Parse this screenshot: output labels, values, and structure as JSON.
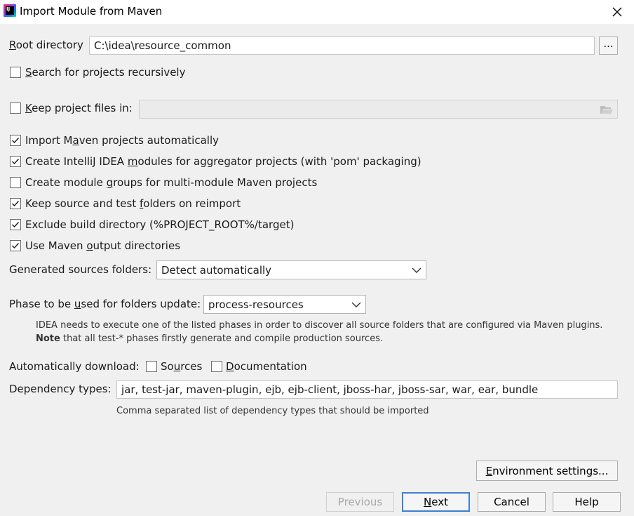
{
  "window": {
    "title": "Import Module from Maven",
    "app_icon": "intellij-idea-icon",
    "app_icon_text": "IJ"
  },
  "root_directory": {
    "label_prefix": "",
    "label_mnemonic": "R",
    "label_rest": "oot directory",
    "value": "C:\\idea\\resource_common",
    "browse_label": "..."
  },
  "search_recursively": {
    "checked": false,
    "label_mnemonic": "S",
    "label_rest": "earch for projects recursively"
  },
  "keep_project_files": {
    "checked": false,
    "label_mnemonic": "K",
    "label_rest": "eep project files in:",
    "value": ""
  },
  "options": [
    {
      "checked": true,
      "pre": "Import M",
      "mn": "a",
      "post": "ven projects automatically"
    },
    {
      "checked": true,
      "pre": "Create IntelliJ IDEA ",
      "mn": "m",
      "post": "odules for aggregator projects (with 'pom' packaging)"
    },
    {
      "checked": false,
      "pre": "Create module ",
      "mn": "g",
      "post": "roups for multi-module Maven projects"
    },
    {
      "checked": true,
      "pre": "Keep source and test ",
      "mn": "f",
      "post": "olders on reimport"
    },
    {
      "checked": true,
      "pre": "Exclude build directory (%PROJECT_ROOT%/target)",
      "mn": "",
      "post": ""
    },
    {
      "checked": true,
      "pre": "Use Maven ",
      "mn": "o",
      "post": "utput directories"
    }
  ],
  "generated_sources": {
    "label": "Generated sources folders:",
    "selected": "Detect automatically"
  },
  "phase": {
    "label_pre": "Phase to be ",
    "label_mn": "u",
    "label_post": "sed for folders update:",
    "selected": "process-resources",
    "hint_line1": "IDEA needs to execute one of the listed phases in order to discover all source folders that are configured via Maven plugins.",
    "hint_bold": "Note",
    "hint_line2": " that all test-* phases firstly generate and compile production sources."
  },
  "auto_download": {
    "label": "Automatically download:",
    "sources": {
      "checked": false,
      "pre": "So",
      "mn": "u",
      "post": "rces"
    },
    "documentation": {
      "checked": false,
      "pre": "",
      "mn": "D",
      "post": "ocumentation"
    }
  },
  "dependency_types": {
    "label": "Dependency types:",
    "value": "jar, test-jar, maven-plugin, ejb, ejb-client, jboss-har, jboss-sar, war, ear, bundle",
    "hint": "Comma separated list of dependency types that should be imported"
  },
  "buttons": {
    "environment_pre": "",
    "environment_mn": "E",
    "environment_post": "nvironment settings...",
    "previous": "Previous",
    "next_mn": "N",
    "next_post": "ext",
    "cancel": "Cancel",
    "help": "Help"
  }
}
